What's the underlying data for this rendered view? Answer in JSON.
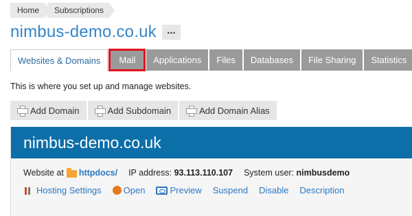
{
  "breadcrumb": {
    "items": [
      "Home",
      "Subscriptions"
    ]
  },
  "page": {
    "title": "nimbus-demo.co.uk",
    "more_label": "..."
  },
  "tabs": [
    {
      "label": "Websites & Domains",
      "active": true
    },
    {
      "label": "Mail",
      "highlighted": true
    },
    {
      "label": "Applications"
    },
    {
      "label": "Files"
    },
    {
      "label": "Databases"
    },
    {
      "label": "File Sharing"
    },
    {
      "label": "Statistics"
    }
  ],
  "intro_text": "This is where you set up and manage websites.",
  "actions": [
    "Add Domain",
    "Add Subdomain",
    "Add Domain Alias"
  ],
  "domain_panel": {
    "name": "nimbus-demo.co.uk",
    "website_at_label": "Website at",
    "website_path": "httpdocs/",
    "ip_label": "IP address:",
    "ip_value": "93.113.110.107",
    "system_user_label": "System user:",
    "system_user_value": "nimbusdemo",
    "links": [
      "Hosting Settings",
      "Open",
      "Preview",
      "Suspend",
      "Disable",
      "Description"
    ]
  },
  "colors": {
    "accent": "#3586c8",
    "panel_header": "#0d6fa8",
    "highlight": "#e3101e",
    "tab_inactive": "#9a9a9a"
  }
}
